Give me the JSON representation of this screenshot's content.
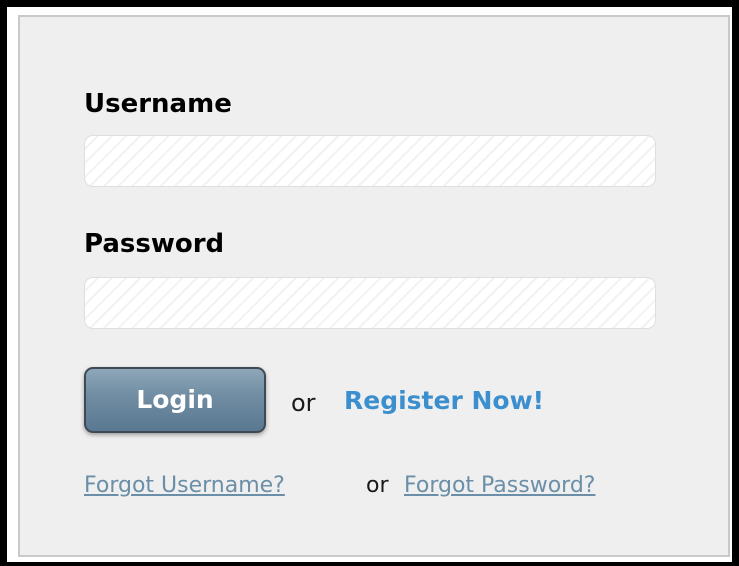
{
  "form": {
    "username_label": "Username",
    "username_value": "",
    "password_label": "Password",
    "password_value": "",
    "login_label": "Login",
    "or_text_1": "or",
    "register_label": "Register Now!",
    "forgot_username_label": "Forgot Username?",
    "or_text_2": "or",
    "forgot_password_label": "Forgot Password?"
  },
  "colors": {
    "panel_background": "#efefef",
    "link_primary": "#3b8fce",
    "link_secondary": "#6b8fa8",
    "button_gradient_top": "#8ea6b8",
    "button_gradient_bottom": "#5a7891"
  }
}
